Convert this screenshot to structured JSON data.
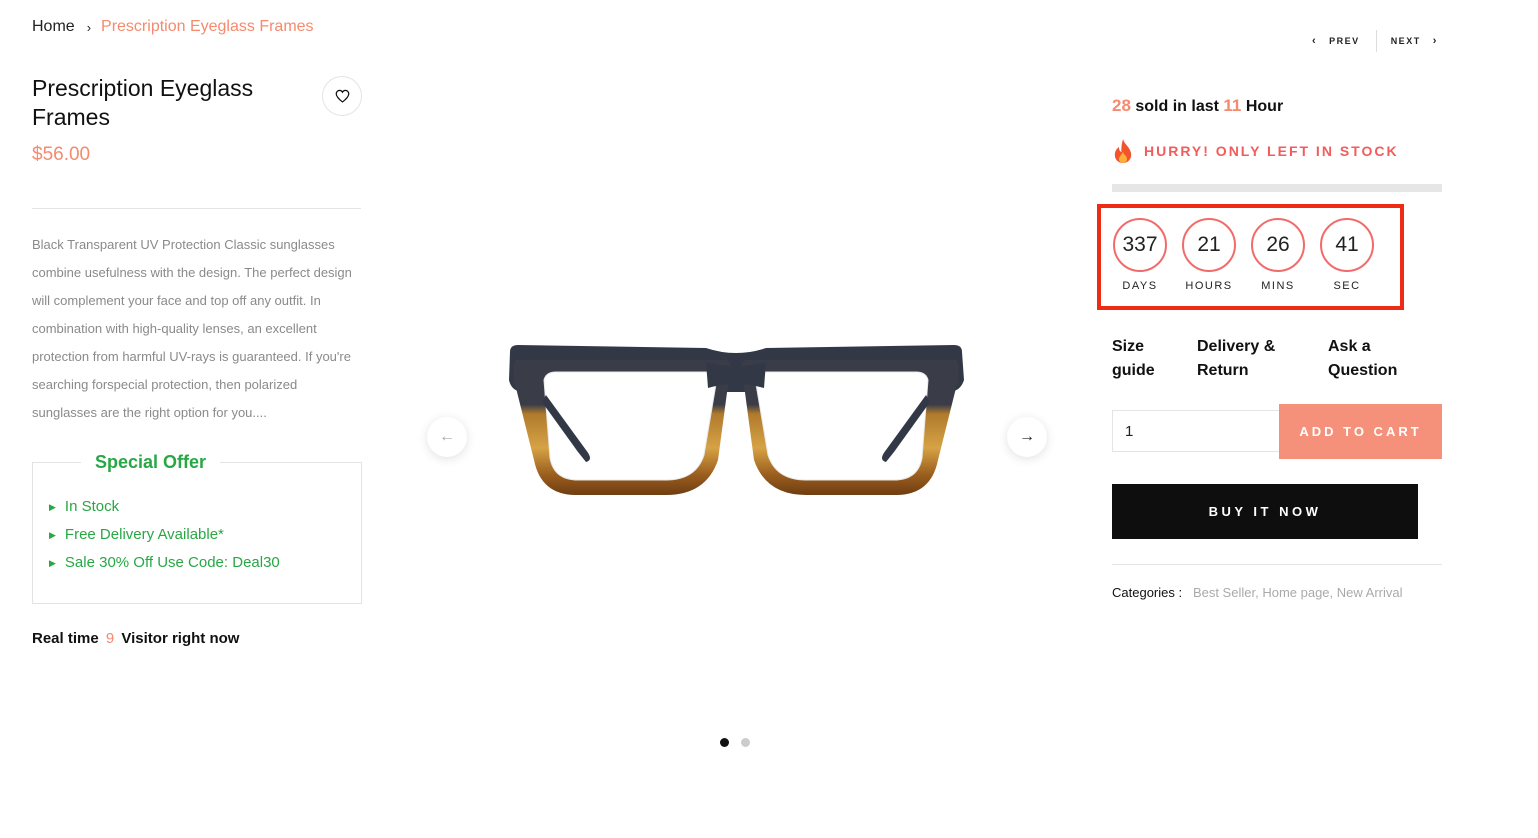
{
  "breadcrumb": {
    "home": "Home",
    "separator": "›",
    "current": "Prescription Eyeglass Frames"
  },
  "pager": {
    "prev": "PREV",
    "next": "NEXT"
  },
  "product": {
    "title": "Prescription Eyeglass Frames",
    "price": "$56.00",
    "description": "Black Transparent UV Protection Classic sunglasses combine usefulness with the design. The perfect design will complement your face and top off any outfit. In combination with high-quality lenses, an excellent protection from harmful UV-rays is guaranteed. If you're searching forspecial protection, then polarized sunglasses are the right option for you...."
  },
  "special_offer": {
    "title": "Special Offer",
    "items": [
      "In Stock",
      "Free Delivery Available*",
      "Sale 30% Off Use Code: Deal30"
    ]
  },
  "visitors": {
    "prefix": "Real time",
    "count": "9",
    "suffix": "Visitor right now"
  },
  "sold": {
    "count": "28",
    "middle": "sold in last",
    "hours": "11",
    "suffix": "Hour"
  },
  "hurry": {
    "text": "HURRY! ONLY LEFT IN STOCK",
    "icon": "fire-icon",
    "stock_bar_fill": 0
  },
  "countdown": [
    {
      "value": "337",
      "unit": "DAYS"
    },
    {
      "value": "21",
      "unit": "HOURS"
    },
    {
      "value": "26",
      "unit": "MINS"
    },
    {
      "value": "41",
      "unit": "SEC"
    }
  ],
  "info_links": {
    "size_guide": [
      "Size",
      "guide"
    ],
    "delivery": [
      "Delivery &",
      "Return"
    ],
    "ask": [
      "Ask a",
      "Question"
    ]
  },
  "cart": {
    "quantity": "1",
    "add_to_cart": "ADD TO CART",
    "buy_now": "BUY IT NOW"
  },
  "categories": {
    "label": "Categories :",
    "items": [
      "Best Seller,",
      "Home page,",
      "New Arrival"
    ]
  },
  "colors": {
    "accent": "#f58a6e",
    "offer_green": "#28a745",
    "hurry_red": "#f25c5c",
    "highlight_border": "#ef2b16"
  }
}
